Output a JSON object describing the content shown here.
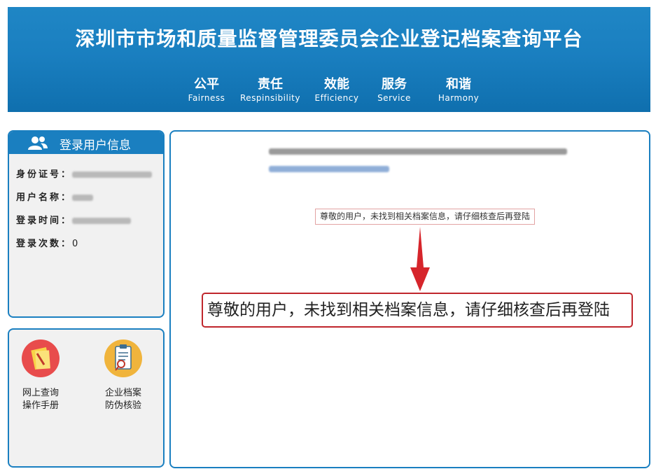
{
  "header": {
    "title": "深圳市市场和质量监督管理委员会企业登记档案查询平台",
    "slogans": [
      {
        "cn": "公平",
        "en": "Fairness"
      },
      {
        "cn": "责任",
        "en": "Respinsibility"
      },
      {
        "cn": "效能",
        "en": "Efficiency"
      },
      {
        "cn": "服务",
        "en": "Service"
      },
      {
        "cn": "和谐",
        "en": "Harmony"
      }
    ],
    "color": "#1a7fc0"
  },
  "user_panel": {
    "title": "登录用户信息",
    "fields": [
      {
        "label": "身份证号：",
        "value": ""
      },
      {
        "label": "用户名称：",
        "value": ""
      },
      {
        "label": "登录时间：",
        "value": ""
      },
      {
        "label": "登录次数：",
        "value": "0"
      }
    ]
  },
  "links": [
    {
      "label_line1": "网上查询",
      "label_line2": "操作手册",
      "icon": "manual-icon"
    },
    {
      "label_line1": "企业档案",
      "label_line2": "防伪核验",
      "icon": "verify-icon"
    }
  ],
  "main": {
    "small_message": "尊敬的用户，未找到相关档案信息，请仔细核查后再登陆",
    "big_message": "尊敬的用户，未找到相关档案信息，请仔细核查后再登陆",
    "accent_red": "#c0262c"
  }
}
